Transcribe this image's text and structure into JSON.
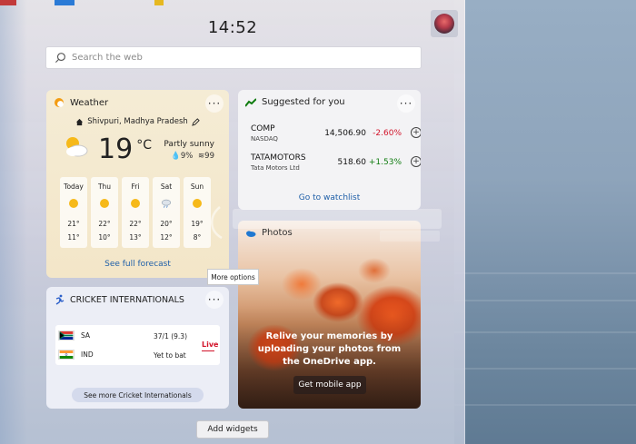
{
  "header": {
    "time": "14:52"
  },
  "search": {
    "placeholder": "Search the web"
  },
  "weather": {
    "title": "Weather",
    "location": "Shivpuri, Madhya Pradesh",
    "temperature": "19",
    "unit": "°C",
    "condition": "Partly sunny",
    "precip": "9%",
    "air": "99",
    "days": [
      {
        "name": "Today",
        "high": "21°",
        "low": "11°",
        "icon": "sun-icon"
      },
      {
        "name": "Thu",
        "high": "22°",
        "low": "10°",
        "icon": "sun-icon"
      },
      {
        "name": "Fri",
        "high": "22°",
        "low": "13°",
        "icon": "sun-icon"
      },
      {
        "name": "Sat",
        "high": "20°",
        "low": "12°",
        "icon": "rain-cloud-icon"
      },
      {
        "name": "Sun",
        "high": "19°",
        "low": "8°",
        "icon": "sun-icon"
      }
    ],
    "forecast_link": "See full forecast"
  },
  "suggested": {
    "title": "Suggested for you",
    "stocks": [
      {
        "name": "COMP",
        "exchange": "NASDAQ",
        "price": "14,506.90",
        "change": "-2.60%",
        "color": "#d2142a"
      },
      {
        "name": "TATAMOTORS",
        "exchange": "Tata Motors Ltd",
        "price": "518.60",
        "change": "+1.53%",
        "color": "#107c10"
      }
    ],
    "watchlist_link": "Go to watchlist"
  },
  "photos": {
    "title": "Photos",
    "message": "Relive your memories by uploading your photos from the OneDrive app.",
    "button": "Get mobile app"
  },
  "tooltip": {
    "text": "More options"
  },
  "cricket": {
    "title": "CRICKET INTERNATIONALS",
    "teams": [
      {
        "name": "SA",
        "score": "37/1 (9.3)"
      },
      {
        "name": "IND",
        "score": "Yet to bat"
      }
    ],
    "status": "Live",
    "see_more": "See more Cricket Internationals"
  },
  "footer": {
    "add_widgets": "Add widgets"
  },
  "more_glyph": "···"
}
